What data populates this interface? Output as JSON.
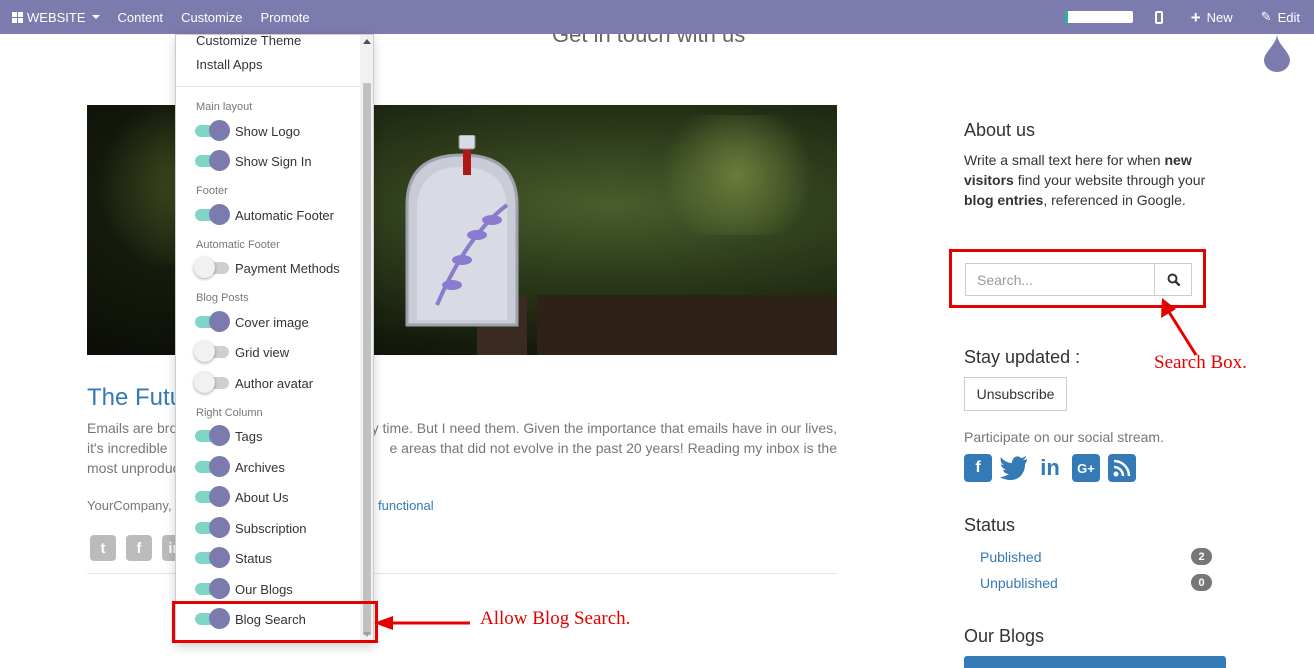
{
  "topbar": {
    "website_label": "WEBSITE",
    "menus": [
      "Content",
      "Customize",
      "Promote"
    ],
    "progress_fraction": 0.05,
    "new_label": "New",
    "edit_label": "Edit"
  },
  "page": {
    "section_heading": "Get in touch with us",
    "post": {
      "title": "The Futu",
      "text_line1_left": "Emails are bro",
      "text_line1_right": "y time. But I need them. Given the importance that emails have in our lives,",
      "text_line2_left": "it's incredible",
      "text_line2_right": "e areas that did not evolve in the past 20 years! Reading my inbox is the",
      "text_line3_left": "most unproduc",
      "meta": "YourCompany,",
      "tag": "functional"
    }
  },
  "dropdown": {
    "menu_items": [
      "Customize Theme",
      "Install Apps"
    ],
    "groups": [
      {
        "header": "Main layout",
        "options": [
          {
            "label": "Show Logo",
            "on": true
          },
          {
            "label": "Show Sign In",
            "on": true
          }
        ]
      },
      {
        "header": "Footer",
        "options": [
          {
            "label": "Automatic Footer",
            "on": true
          }
        ]
      },
      {
        "header": "Automatic Footer",
        "options": [
          {
            "label": "Payment Methods",
            "on": false
          }
        ]
      },
      {
        "header": "Blog Posts",
        "options": [
          {
            "label": "Cover image",
            "on": true
          },
          {
            "label": "Grid view",
            "on": false
          },
          {
            "label": "Author avatar",
            "on": false
          }
        ]
      },
      {
        "header": "Right Column",
        "options": [
          {
            "label": "Tags",
            "on": true
          },
          {
            "label": "Archives",
            "on": true
          },
          {
            "label": "About Us",
            "on": true
          },
          {
            "label": "Subscription",
            "on": true
          },
          {
            "label": "Status",
            "on": true
          },
          {
            "label": "Our Blogs",
            "on": true
          },
          {
            "label": "Blog Search",
            "on": true
          }
        ]
      }
    ]
  },
  "sidebar": {
    "about_title": "About us",
    "about_text": {
      "p1": "Write a small text here for when ",
      "b1": "new visitors",
      "p2": " find your website through your ",
      "b2": "blog entries",
      "p3": ", referenced in Google."
    },
    "search_placeholder": "Search...",
    "stay_updated_title": "Stay updated :",
    "unsubscribe_label": "Unsubscribe",
    "participate_text": "Participate on our social stream.",
    "status_title": "Status",
    "status_items": [
      {
        "label": "Published",
        "count": "2"
      },
      {
        "label": "Unpublished",
        "count": "0"
      }
    ],
    "our_blogs_title": "Our Blogs"
  },
  "annotations": {
    "search_box": "Search Box.",
    "allow_blog_search": "Allow Blog Search."
  },
  "colors": {
    "topbar": "#7c7bad",
    "toggle_on_track": "#7fd6c8",
    "toggle_on_knob": "#7c7bad",
    "link": "#337ab7",
    "annotation": "#e50000"
  }
}
